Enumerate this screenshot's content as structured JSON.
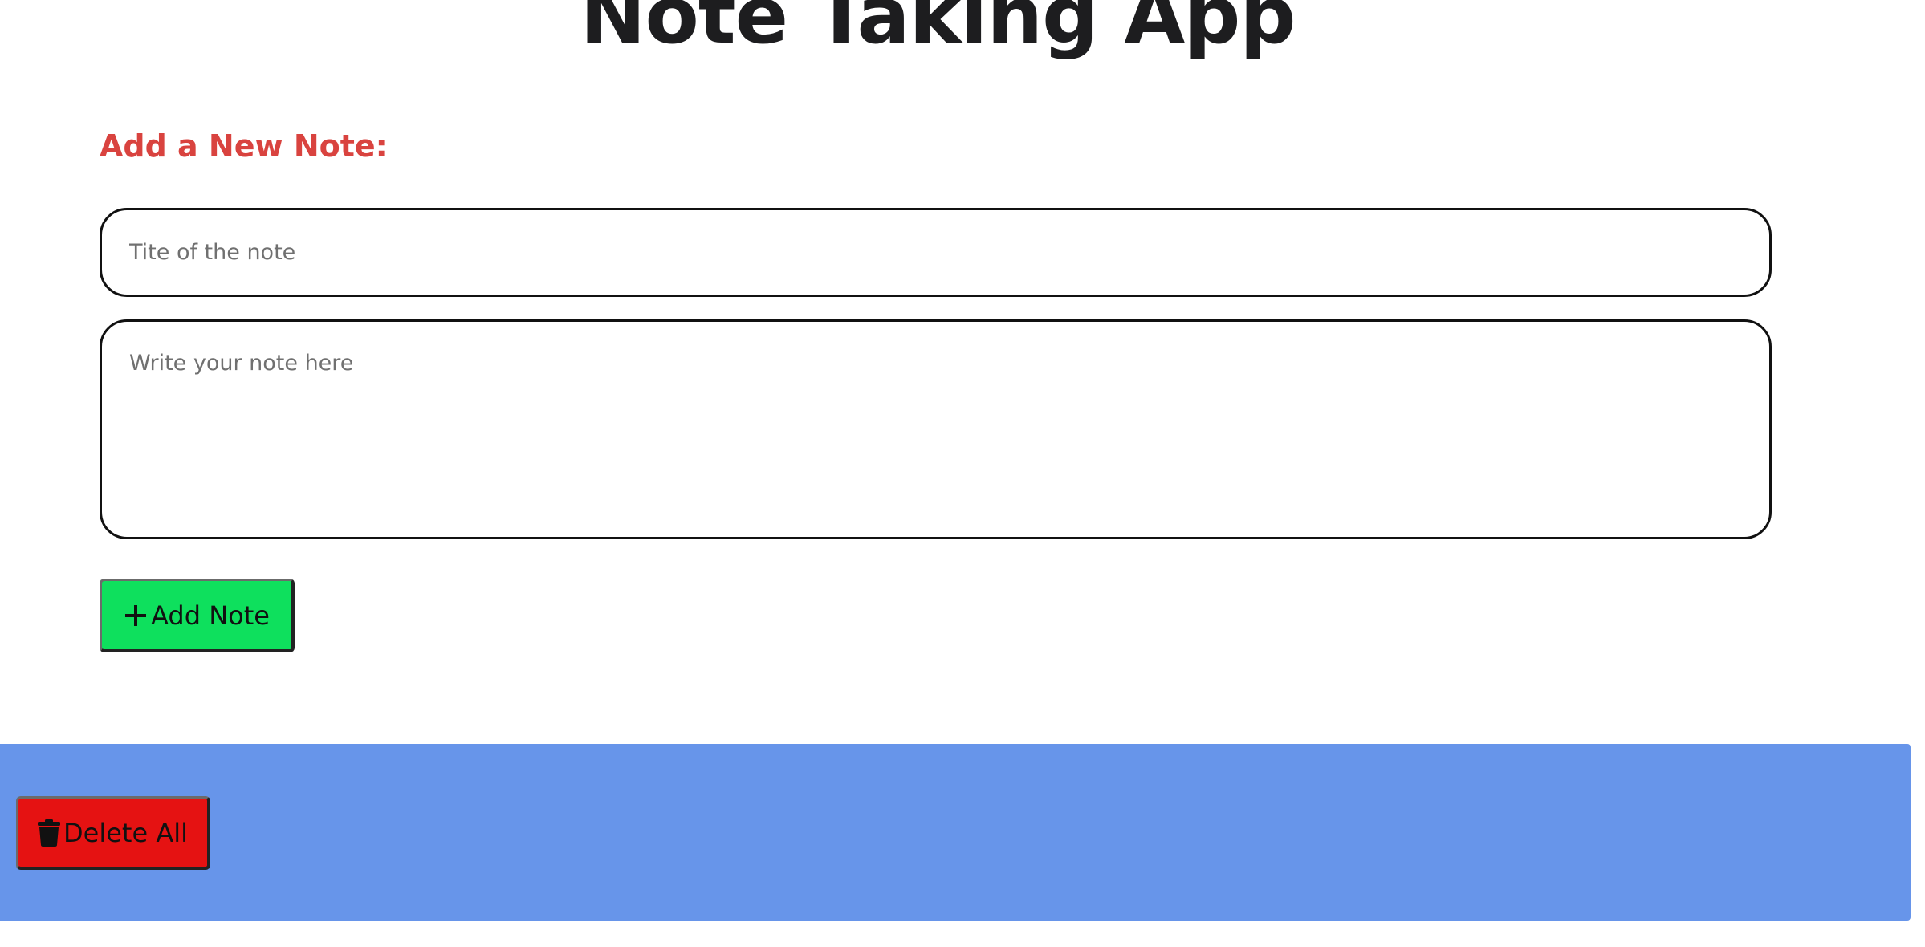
{
  "app": {
    "title": "Note Taking App"
  },
  "form": {
    "heading": "Add a New Note:",
    "title_placeholder": "Tite of the note",
    "title_value": "",
    "body_placeholder": "Write your note here",
    "body_value": "",
    "add_button_label": "Add Note",
    "add_button_icon": "plus-icon"
  },
  "footer": {
    "delete_all_label": "Delete All",
    "delete_all_icon": "trash-icon"
  },
  "colors": {
    "heading_accent": "#d9433f",
    "add_button": "#0ee05d",
    "delete_button": "#e51212",
    "footer_band": "#6795ea"
  }
}
